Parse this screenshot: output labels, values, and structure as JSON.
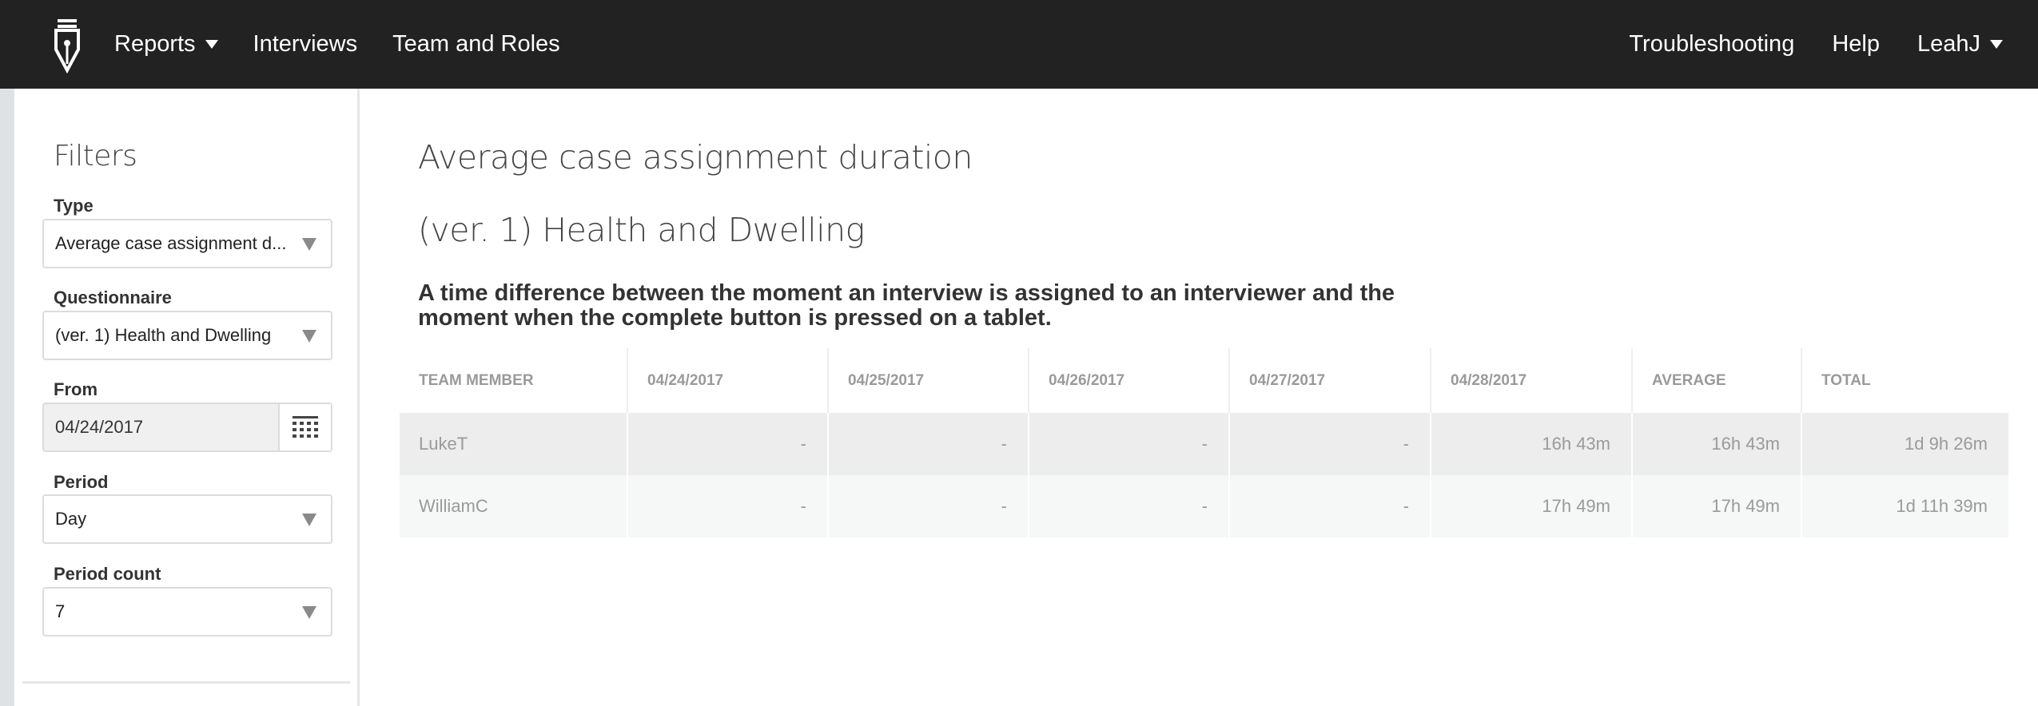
{
  "nav": {
    "left": [
      {
        "label": "Reports",
        "dropdown": true
      },
      {
        "label": "Interviews",
        "dropdown": false
      },
      {
        "label": "Team and Roles",
        "dropdown": false
      }
    ],
    "right": [
      {
        "label": "Troubleshooting",
        "dropdown": false
      },
      {
        "label": "Help",
        "dropdown": false
      },
      {
        "label": "LeahJ",
        "dropdown": true
      }
    ],
    "logo_icon": "pen-nib-logo-icon"
  },
  "filters": {
    "title": "Filters",
    "type": {
      "label": "Type",
      "value": "Average case assignment d..."
    },
    "questionnaire": {
      "label": "Questionnaire",
      "value": "(ver. 1) Health and Dwelling"
    },
    "from": {
      "label": "From",
      "value": "04/24/2017",
      "icon": "calendar-icon"
    },
    "period": {
      "label": "Period",
      "value": "Day"
    },
    "period_count": {
      "label": "Period count",
      "value": "7"
    }
  },
  "report": {
    "title": "Average case assignment duration",
    "subtitle": "(ver. 1) Health and Dwelling",
    "description": "A time difference between the moment an interview is assigned to an interviewer and the moment when the complete button is pressed on a tablet.",
    "columns": [
      "Team member",
      "04/24/2017",
      "04/25/2017",
      "04/26/2017",
      "04/27/2017",
      "04/28/2017",
      "Average",
      "Total"
    ],
    "rows": [
      [
        "LukeT",
        "-",
        "-",
        "-",
        "-",
        "16h 43m",
        "16h 43m",
        "1d 9h 26m"
      ],
      [
        "WilliamC",
        "-",
        "-",
        "-",
        "-",
        "17h 49m",
        "17h 49m",
        "1d 11h 39m"
      ]
    ]
  },
  "colors": {
    "navbar": "#222222",
    "row_odd": "#ededee",
    "row_even": "#f6f7f7",
    "muted_text": "#9a9a9a"
  }
}
